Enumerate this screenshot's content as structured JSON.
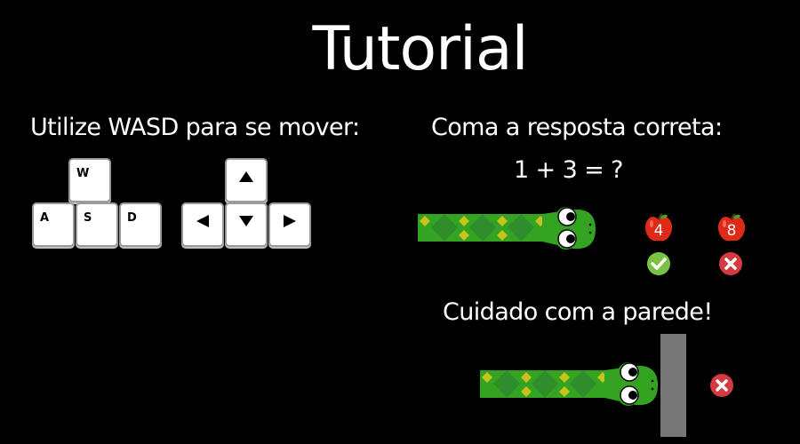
{
  "title": "Tutorial",
  "controls": {
    "heading": "Utilize WASD para se mover:",
    "wasd_keys": {
      "w": "W",
      "a": "A",
      "s": "S",
      "d": "D"
    },
    "arrow_keys": [
      "arrow-up-icon",
      "arrow-left-icon",
      "arrow-down-icon",
      "arrow-right-icon"
    ]
  },
  "answer": {
    "heading": "Coma a resposta correta:",
    "question": "1 + 3 = ?",
    "options": [
      {
        "value": "4",
        "result": "check-icon",
        "color": "#7cc242"
      },
      {
        "value": "8",
        "result": "x-icon",
        "color": "#d43a3f"
      }
    ]
  },
  "wall": {
    "heading": "Cuidado com a parede!",
    "result": "x-icon"
  },
  "colors": {
    "background": "#000000",
    "snake_body": "#33a321",
    "snake_diamond": "#2f8d2c",
    "snake_accent": "#c9c31e",
    "apple_red": "#e02a18",
    "wall": "#777777",
    "correct": "#7cc242",
    "wrong": "#d43a3f"
  }
}
